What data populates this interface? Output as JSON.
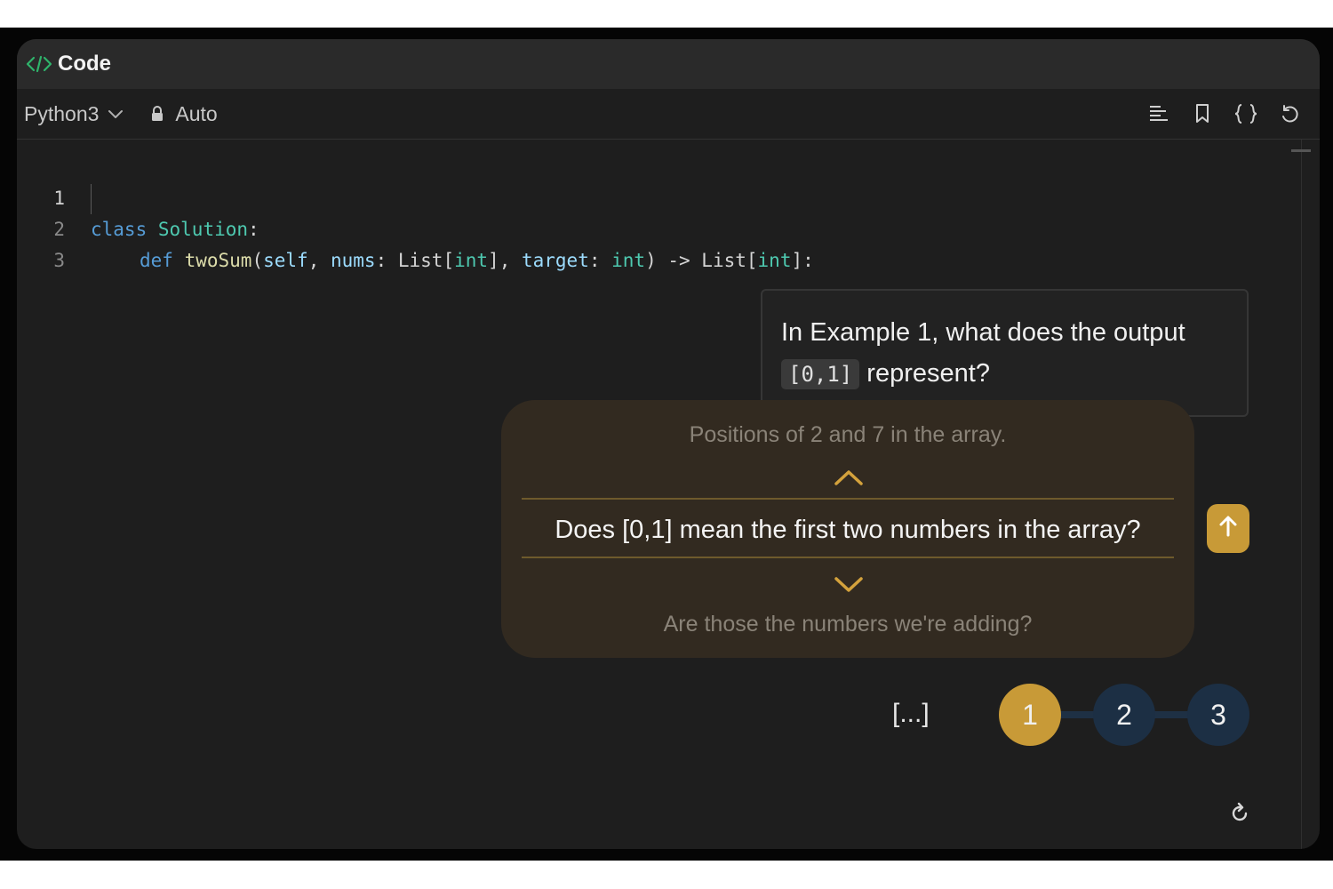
{
  "window": {
    "title": "Code"
  },
  "toolbar": {
    "language": "Python3",
    "mode": "Auto"
  },
  "editor": {
    "line_numbers": [
      "1",
      "2",
      "3"
    ],
    "line1": {
      "kw": "class",
      "cls": "Solution",
      "colon": ":"
    },
    "line2": {
      "kw": "def",
      "fn": "twoSum",
      "open": "(",
      "self": "self",
      "comma1": ", ",
      "nums": "nums",
      "colon1": ": ",
      "list1": "List",
      "br1o": "[",
      "int1": "int",
      "br1c": "]",
      "comma2": ", ",
      "target": "target",
      "colon2": ": ",
      "int2": "int",
      "close": ") -> ",
      "list2": "List",
      "br2o": "[",
      "int3": "int",
      "br2c": "]",
      "end": ":"
    }
  },
  "question": {
    "prefix": "In Example 1, what does the output",
    "code": "[0,1]",
    "suffix": " represent?"
  },
  "suggestions": {
    "previous": "Positions of 2 and 7 in the array.",
    "current": "Does [0,1] mean the first two numbers in the array?",
    "next": "Are those the numbers we're adding?"
  },
  "steps": {
    "ellipsis": "[...]",
    "items": [
      "1",
      "2",
      "3"
    ],
    "active_index": 0
  },
  "colors": {
    "accent": "#c89a37",
    "step_inactive": "#1c2f44",
    "keyword": "#569cd6",
    "class_type": "#4ec9b0",
    "function": "#dcdcaa",
    "parameter": "#9cdcfe"
  }
}
